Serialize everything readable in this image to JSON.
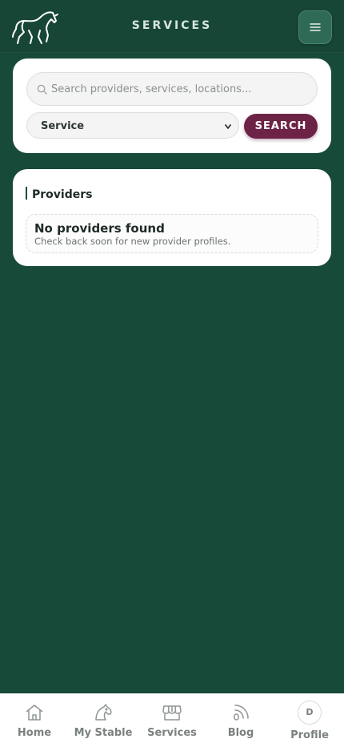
{
  "header": {
    "title": "SERVICES",
    "logo_icon": "horse-logo-icon",
    "menu_icon": "hamburger-menu-icon"
  },
  "search": {
    "placeholder": "Search providers, services, locations...",
    "value": "",
    "filter_selected": "Service",
    "button_label": "SEARCH"
  },
  "providers": {
    "title": "Providers",
    "empty_title": "No providers found",
    "empty_message": "Check back soon for new provider profiles."
  },
  "bottom_nav": {
    "items": [
      {
        "label": "Home",
        "icon": "home-icon"
      },
      {
        "label": "My Stable",
        "icon": "horse-head-icon"
      },
      {
        "label": "Services",
        "icon": "storefront-icon"
      },
      {
        "label": "Blog",
        "icon": "rss-icon"
      },
      {
        "label": "Profile",
        "icon": "avatar",
        "avatar_initial": "D"
      }
    ]
  },
  "colors": {
    "background": "#184a3a",
    "header": "#174636",
    "accent_button": "#6d2346",
    "card": "#ffffff"
  }
}
